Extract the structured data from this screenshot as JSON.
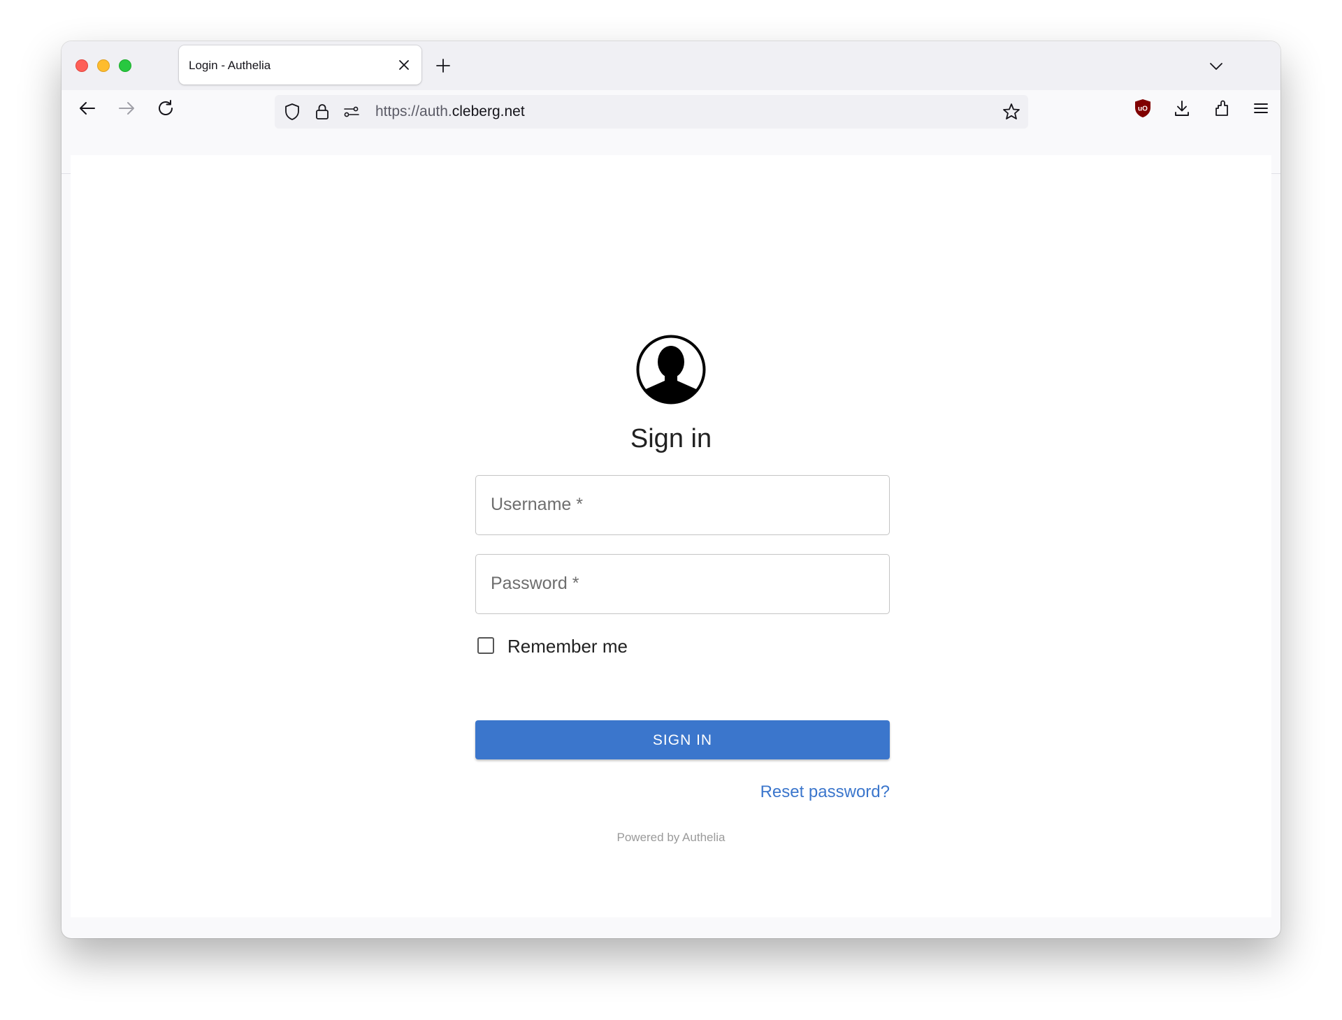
{
  "browser": {
    "tab": {
      "title": "Login - Authelia"
    },
    "url": {
      "prefix": "https://auth.",
      "domain": "cleberg.net"
    },
    "colors": {
      "close_red": "#fe5f57",
      "minimize_yellow": "#febc2e",
      "zoom_green": "#28c840",
      "ublock_red": "#800000"
    },
    "icons": [
      "back-icon",
      "forward-icon",
      "reload-icon",
      "shield-icon",
      "lock-icon",
      "permissions-icon",
      "star-icon",
      "ublock-icon",
      "download-icon",
      "extensions-icon",
      "menu-icon"
    ]
  },
  "login": {
    "title": "Sign in",
    "username_label": "Username",
    "password_label": "Password",
    "required_mark": "*",
    "remember_label": "Remember me",
    "remember_checked": false,
    "signin_label": "SIGN IN",
    "reset_label": "Reset password?",
    "powered_by": "Powered by Authelia",
    "colors": {
      "primary": "#3b76cc",
      "text": "#212121"
    }
  }
}
